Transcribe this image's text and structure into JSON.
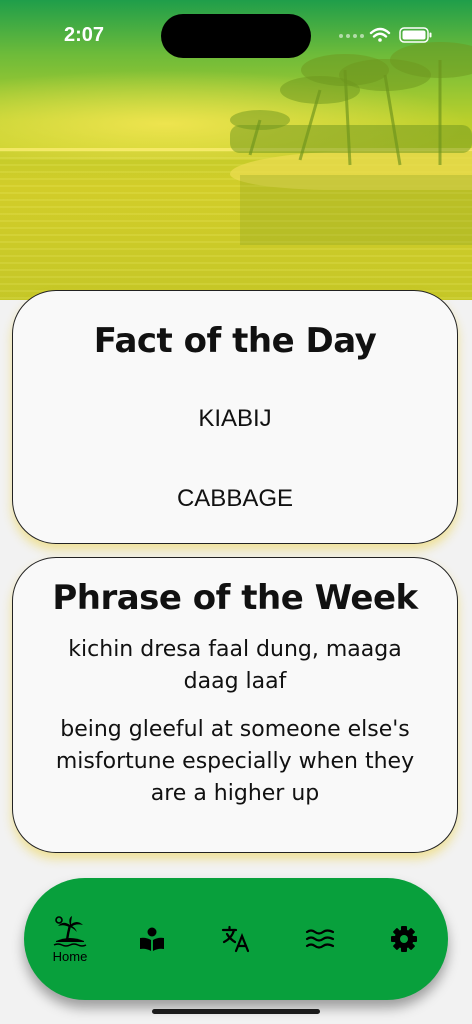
{
  "status_bar": {
    "time": "2:07"
  },
  "fact_card": {
    "title": "Fact of the Day",
    "local_word": "KIABIJ",
    "english_word": "CABBAGE"
  },
  "phrase_card": {
    "title": "Phrase of the Week",
    "local_phrase": "kichin dresa faal dung, maaga daag laaf",
    "meaning": "being gleeful at someone else's misfortune especially when they are a higher up"
  },
  "tab_bar": {
    "accent_color": "#08a03c",
    "tabs": [
      {
        "icon": "palm-island-icon",
        "label": "Home"
      },
      {
        "icon": "book-reader-icon"
      },
      {
        "icon": "translate-icon"
      },
      {
        "icon": "waves-icon"
      },
      {
        "icon": "gear-icon"
      }
    ]
  }
}
